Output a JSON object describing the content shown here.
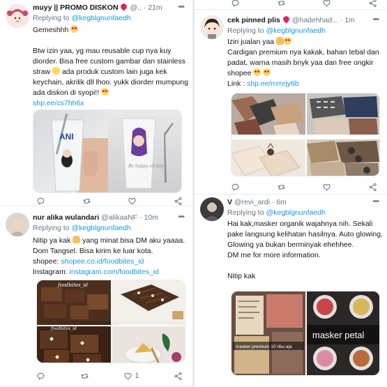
{
  "left": {
    "tweet1": {
      "name": "muyy || PROMO DISKON",
      "handle": "@..",
      "time": "21m",
      "reply_prefix": "Replying to",
      "reply_handle": "@kegblgnunfaedh",
      "line1": "Gemeshhh",
      "line2": "Btw izin yaa, yg mau reusable cup nya kuy diorder. Bisa free custom gambar dan stainless straw",
      "line3": "ada produk custom lain juga kek keychain, akrilik dll lhoo. yukk diorder mumpung ada diskon di syopi!!",
      "link": "shp.ee/cs7hh6x",
      "cup_label": "ANI",
      "cup_script": "Be happy all day",
      "like_count": "",
      "reply_count": ""
    },
    "tweet2": {
      "name": "nur alika wulandari",
      "handle": "@alikaaNF",
      "time": "10m",
      "reply_prefix": "Replying to",
      "reply_handle": "@kegblgnunfaedh",
      "line1a": "Nitip ya kak",
      "line1b": "yang minat bisa DM aku yaaaa. Dom Tangsel. Bisa kirim ke luar kota.",
      "shopee_label": "shopee:",
      "shopee_link": "shopee.co.id/foodbites_id",
      "ig_label": "Instagram:",
      "ig_link": "instagram.com/foodbites_id",
      "watermark": "foodbites_id",
      "like_count": "1"
    }
  },
  "right": {
    "tweet3": {
      "name": "cek pinned plis",
      "handle": "@hadehhad...",
      "time": "1m",
      "reply_prefix": "Replying to",
      "reply_handle": "@kegblgnunfaedh",
      "line1": "Izin jualan yaa",
      "line2": "Cardigan premium nya kakak, bahan tebal dan padat, warna masih bnyk yaa dan free ongkir shopee",
      "link_label": "Link :",
      "link": "shp.ee/mmrjy6b"
    },
    "tweet4": {
      "name": "V",
      "handle": "@revi_ardi",
      "time": "6m",
      "reply_prefix": "Replying to",
      "reply_handle": "@kegblgnunfaedh",
      "line1": "Hai kak,masker organik wajahnya nih. Sekali pake langsung kelihatan hasilnya. Auto glowing. Glowing ya bukan berminyak ehehhee.",
      "line2": "DM me for more information.",
      "line3": "Nitip kak",
      "img_caption_small": "masker premium 10 ribu aja",
      "img_caption": "masker petal"
    }
  },
  "colors": {
    "link": "#1b95e0",
    "muted": "#657786",
    "border": "#e6ecf0",
    "text": "#14171a"
  },
  "icons": [
    "reply-icon",
    "retweet-icon",
    "like-icon",
    "share-icon",
    "more-icon",
    "pin-emoji",
    "heart-eyes-emoji",
    "hug-emoji",
    "pray-emoji",
    "red-heart-emoji"
  ]
}
